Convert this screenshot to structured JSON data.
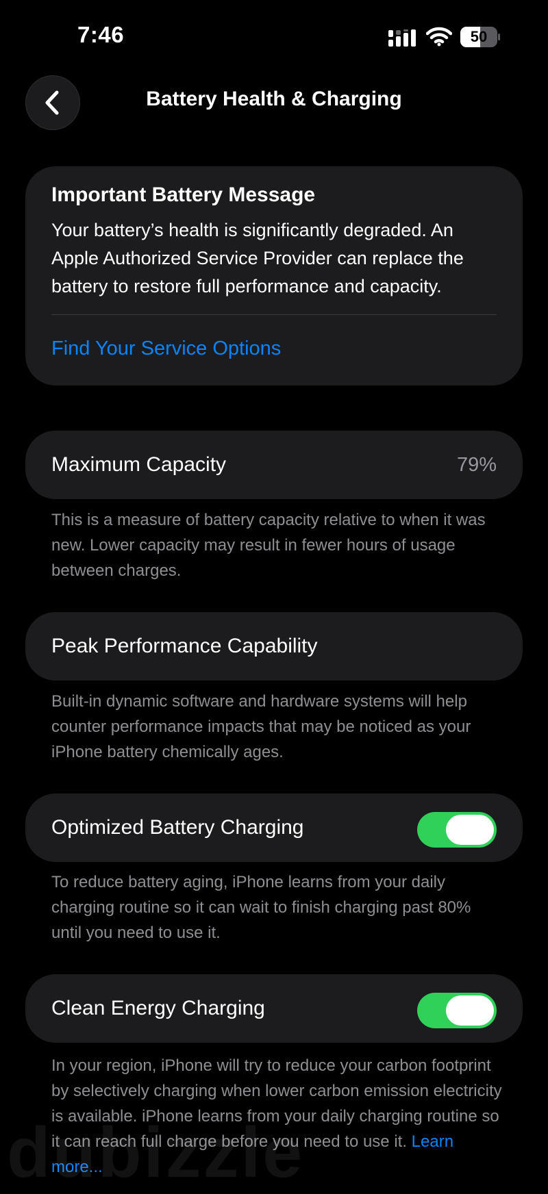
{
  "status_bar": {
    "time": "7:46",
    "battery_level": "50",
    "icons": [
      "cellular-signal-icon",
      "wifi-icon",
      "battery-icon"
    ]
  },
  "nav": {
    "back_icon": "chevron-left-icon",
    "title": "Battery Health & Charging"
  },
  "message_card": {
    "title": "Important Battery Message",
    "body": "Your battery’s health is significantly degraded. An Apple Authorized Service Provider can replace the battery to restore full performance and capacity.",
    "link": "Find Your Service Options"
  },
  "maximum_capacity": {
    "label": "Maximum Capacity",
    "value": "79%",
    "footnote": "This is a measure of battery capacity relative to when it was new. Lower capacity may result in fewer hours of usage between charges."
  },
  "peak_performance": {
    "label": "Peak Performance Capability",
    "footnote": "Built-in dynamic software and hardware systems will help counter performance impacts that may be noticed as your iPhone battery chemically ages."
  },
  "optimized_charging": {
    "label": "Optimized Battery Charging",
    "enabled": true,
    "footnote": "To reduce battery aging, iPhone learns from your daily charging routine so it can wait to finish charging past 80% until you need to use it."
  },
  "clean_energy": {
    "label": "Clean Energy Charging",
    "enabled": true,
    "footnote": "In your region, iPhone will try to reduce your carbon footprint by selectively charging when lower carbon emission electricity is available. iPhone learns from your daily charging routine so it can reach full charge before you need to use it.",
    "learn_more": "Learn more..."
  },
  "watermark": "dubizzle",
  "colors": {
    "background": "#000000",
    "card": "#1c1c1e",
    "link": "#0a84ff",
    "toggle_on": "#30d158",
    "secondary_text": "#8e8e93"
  }
}
